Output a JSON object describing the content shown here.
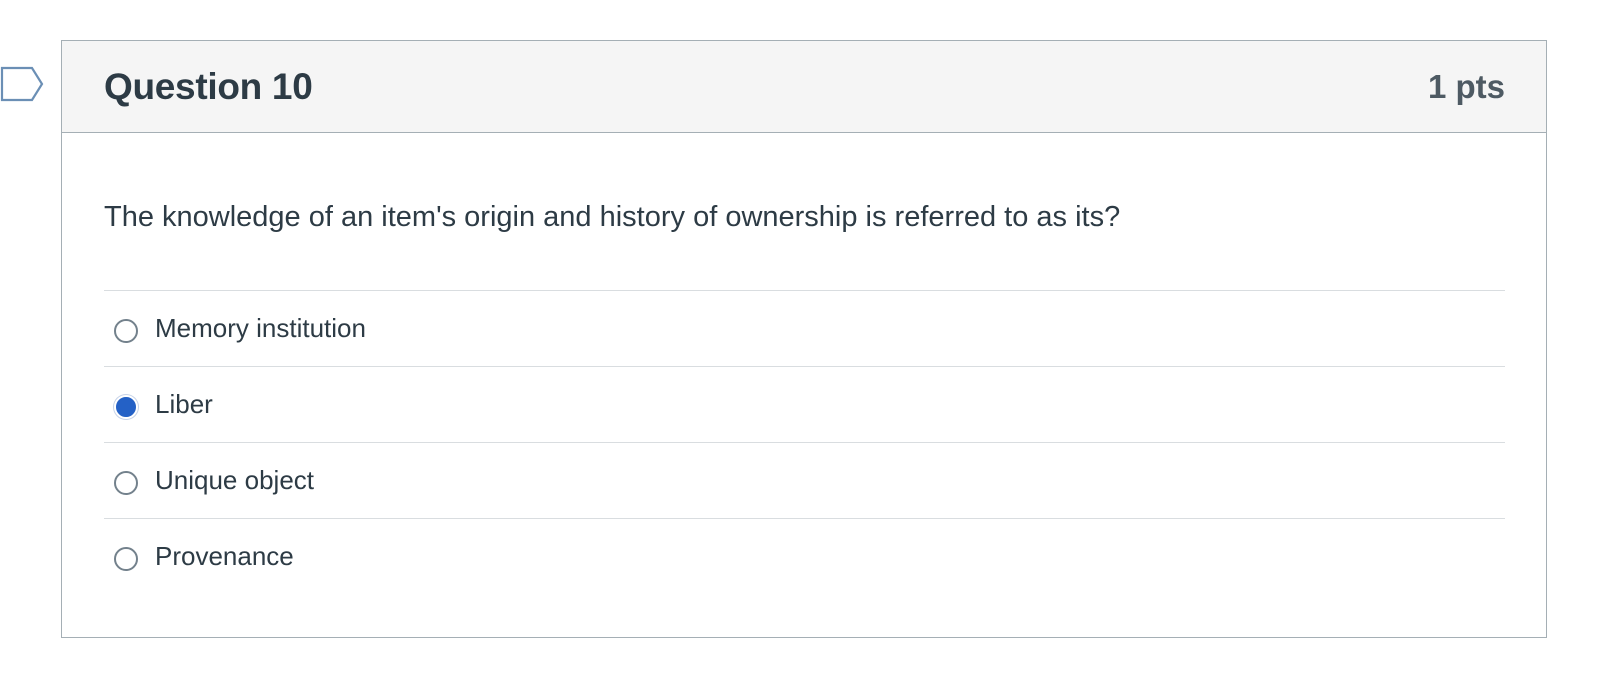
{
  "question": {
    "title": "Question 10",
    "points": "1 pts",
    "text": "The knowledge of an item's origin and history of ownership is referred to as its?",
    "answers": [
      {
        "label": "Memory institution",
        "selected": false
      },
      {
        "label": "Liber",
        "selected": true
      },
      {
        "label": "Unique object",
        "selected": false
      },
      {
        "label": "Provenance",
        "selected": false
      }
    ]
  },
  "flag": {
    "icon": "flag-bookmark-icon"
  },
  "colors": {
    "accent": "#2461c6",
    "header_bg": "#f5f5f5",
    "border": "#a5afb5",
    "text": "#2d3b45"
  }
}
